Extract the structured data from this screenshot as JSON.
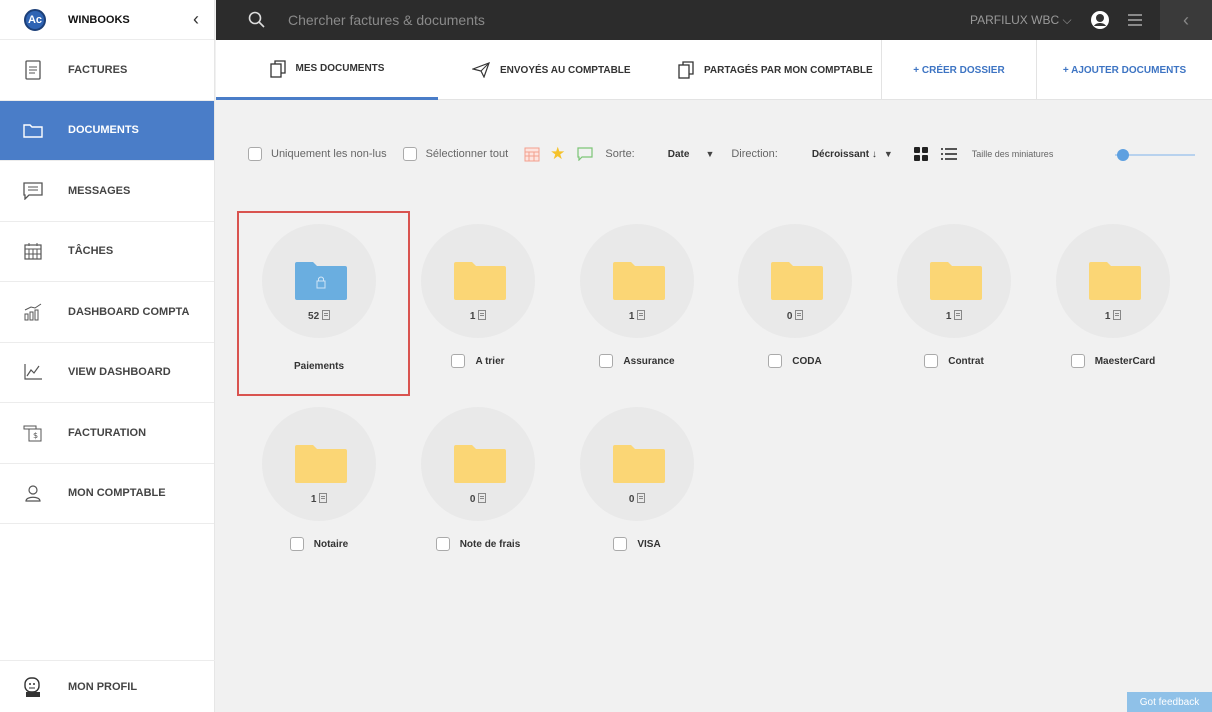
{
  "brand": {
    "logo": "Ac",
    "name": "WINBOOKS"
  },
  "sidebar": {
    "items": [
      {
        "label": "FACTURES",
        "icon": "invoice-icon"
      },
      {
        "label": "DOCUMENTS",
        "icon": "folder-icon",
        "active": true
      },
      {
        "label": "MESSAGES",
        "icon": "message-icon"
      },
      {
        "label": "TÂCHES",
        "icon": "calendar-icon"
      },
      {
        "label": "DASHBOARD COMPTA",
        "icon": "bar-chart-icon"
      },
      {
        "label": "VIEW DASHBOARD",
        "icon": "line-chart-icon"
      },
      {
        "label": "FACTURATION",
        "icon": "billing-icon"
      },
      {
        "label": "MON COMPTABLE",
        "icon": "user-icon"
      }
    ],
    "profile_label": "MON PROFIL"
  },
  "topbar": {
    "search_placeholder": "Chercher factures & documents",
    "company": "PARFILUX WBC ⌵"
  },
  "tabs": [
    {
      "label": "MES DOCUMENTS",
      "active": true
    },
    {
      "label": "ENVOYÉS AU COMPTABLE"
    },
    {
      "label": "PARTAGÉS PAR MON COMPTABLE"
    }
  ],
  "actions": {
    "create_folder": "+ CRÉER DOSSIER",
    "add_documents": "+ AJOUTER DOCUMENTS"
  },
  "toolbar": {
    "unread_only": "Uniquement les non-lus",
    "select_all": "Sélectionner tout",
    "sort_label": "Sorte:",
    "sort_value": "Date",
    "direction_label": "Direction:",
    "direction_value": "Décroissant ↓",
    "thumb_size_label": "Taille des miniatures",
    "thumb_size_level": 0.1
  },
  "folders": [
    {
      "name": "Paiements",
      "count": "52",
      "locked": true,
      "color": "#6aaee0"
    },
    {
      "name": "A trier",
      "count": "1",
      "color": "#fbd675"
    },
    {
      "name": "Assurance",
      "count": "1",
      "color": "#fbd675"
    },
    {
      "name": "CODA",
      "count": "0",
      "color": "#fbd675"
    },
    {
      "name": "Contrat",
      "count": "1",
      "color": "#fbd675"
    },
    {
      "name": "MaesterCard",
      "count": "1",
      "color": "#fbd675"
    },
    {
      "name": "Notaire",
      "count": "1",
      "color": "#fbd675"
    },
    {
      "name": "Note de frais",
      "count": "0",
      "color": "#fbd675"
    },
    {
      "name": "VISA",
      "count": "0",
      "color": "#fbd675"
    }
  ],
  "feedback": "Got feedback",
  "colors": {
    "accent": "#4a7dc8",
    "folder": "#fbd675",
    "locked_folder": "#6aaee0",
    "topbar": "#2c2c2c"
  }
}
